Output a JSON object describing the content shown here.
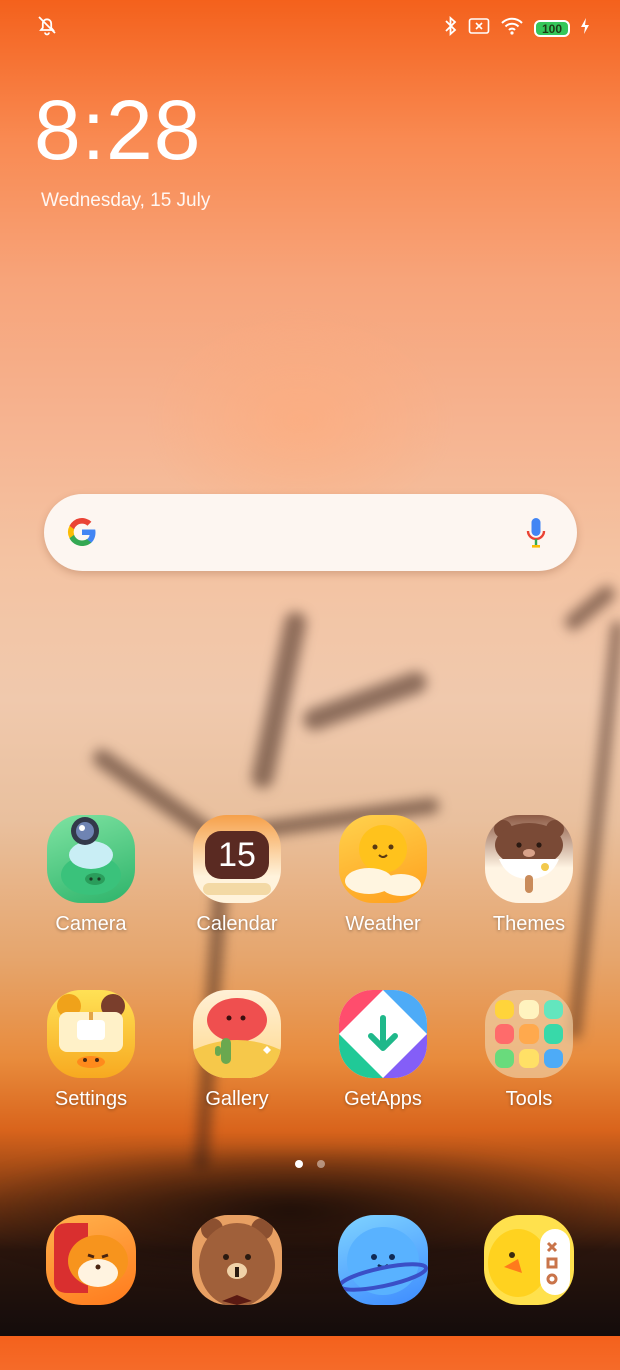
{
  "status_bar": {
    "left_icon": "silent-mode-icon",
    "icons": [
      "bluetooth-icon",
      "no-sim-icon",
      "wifi-icon",
      "battery-icon",
      "charging-icon"
    ],
    "battery_level": "100"
  },
  "clock": {
    "time": "8:28",
    "date": "Wednesday, 15 July"
  },
  "search": {
    "logo": "google-logo-icon",
    "mic": "voice-search-icon"
  },
  "apps_row1": [
    {
      "label": "Camera",
      "icon": "camera-icon"
    },
    {
      "label": "Calendar",
      "icon": "calendar-icon",
      "badge": "15"
    },
    {
      "label": "Weather",
      "icon": "weather-icon"
    },
    {
      "label": "Themes",
      "icon": "themes-icon"
    }
  ],
  "apps_row2": [
    {
      "label": "Settings",
      "icon": "settings-icon"
    },
    {
      "label": "Gallery",
      "icon": "gallery-icon"
    },
    {
      "label": "GetApps",
      "icon": "getapps-icon"
    },
    {
      "label": "Tools",
      "icon": "tools-folder-icon"
    }
  ],
  "page_indicator": {
    "pages": 2,
    "active": 1
  },
  "dock": [
    "phone-icon",
    "messaging-icon",
    "browser-icon",
    "game-icon"
  ],
  "colors": {
    "wallpaper_top": "#f4611c",
    "wallpaper_mid": "#f4c3a2",
    "wallpaper_bottom": "#140c0b",
    "search_bg": "#fdf6f1",
    "battery_green": "#34c75a"
  }
}
